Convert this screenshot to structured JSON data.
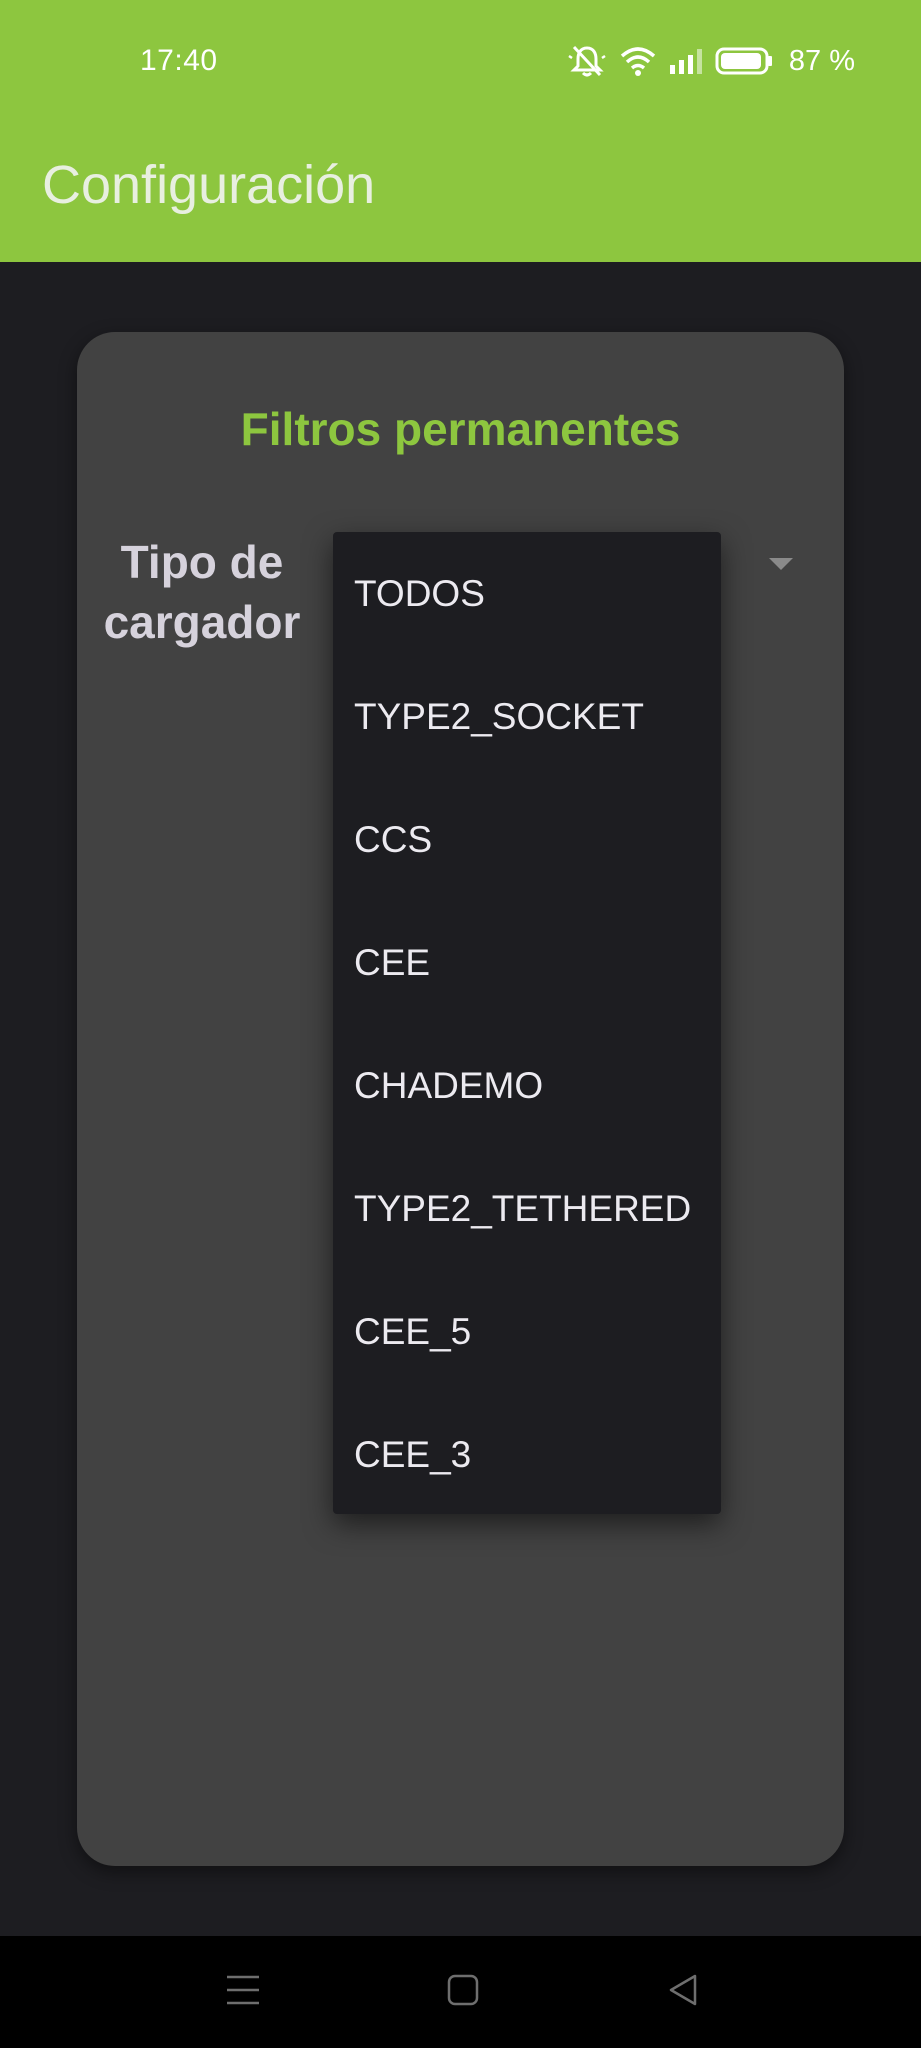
{
  "status_bar": {
    "time": "17:40",
    "battery_percent": "87 %",
    "icons": [
      "muted-bell-icon",
      "wifi-icon",
      "signal-icon",
      "battery-icon"
    ]
  },
  "app_bar": {
    "title": "Configuración"
  },
  "card": {
    "title": "Filtros permanentes",
    "field_label": "Tipo de cargador"
  },
  "dropdown": {
    "options": [
      "TODOS",
      "TYPE2_SOCKET",
      "CCS",
      "CEE",
      "CHADEMO",
      "TYPE2_TETHERED",
      "CEE_5",
      "CEE_3"
    ]
  },
  "nav_bar": {
    "icons": [
      "menu-icon",
      "home-icon",
      "back-icon"
    ]
  },
  "colors": {
    "accent": "#8dc63f",
    "background": "#1d1d21",
    "card": "#424242"
  }
}
